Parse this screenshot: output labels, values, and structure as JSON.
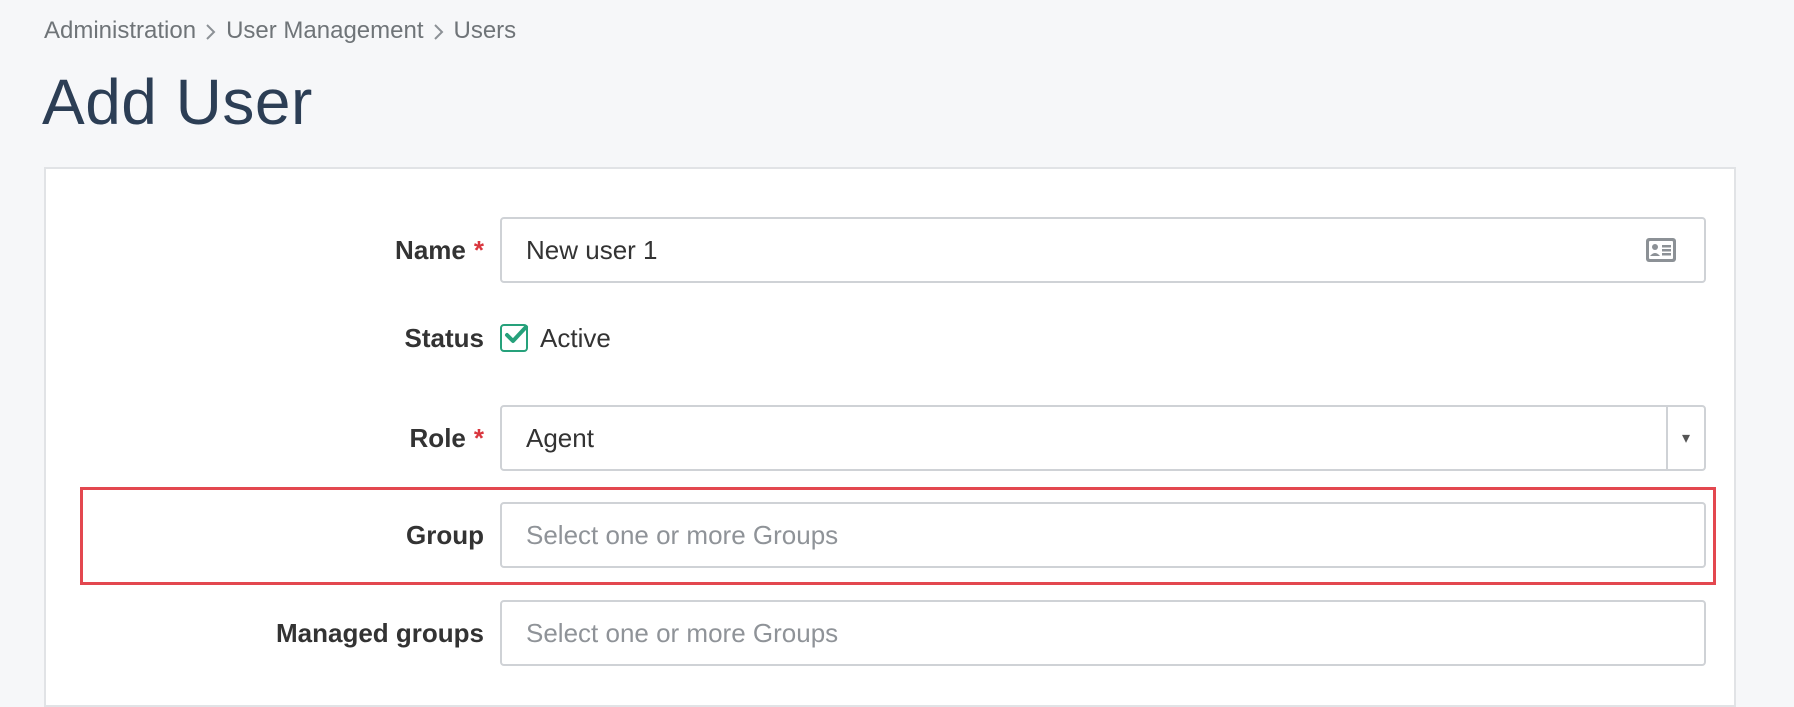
{
  "breadcrumb": {
    "items": [
      "Administration",
      "User Management",
      "Users"
    ]
  },
  "page": {
    "title": "Add User"
  },
  "form": {
    "name": {
      "label": "Name",
      "required_marker": "*",
      "value": "New user 1",
      "icon": "contact-card-icon"
    },
    "status": {
      "label": "Status",
      "checkbox_label": "Active",
      "checked": true,
      "check_color": "#26a17b"
    },
    "role": {
      "label": "Role",
      "required_marker": "*",
      "selected": "Agent",
      "caret": "▾"
    },
    "group": {
      "label": "Group",
      "placeholder": "Select one or more Groups"
    },
    "managed_groups": {
      "label": "Managed groups",
      "placeholder": "Select one or more Groups"
    }
  },
  "colors": {
    "title": "#2c3e55",
    "required": "#d9363e",
    "highlight": "#e3474f",
    "background": "#f6f7f9"
  }
}
